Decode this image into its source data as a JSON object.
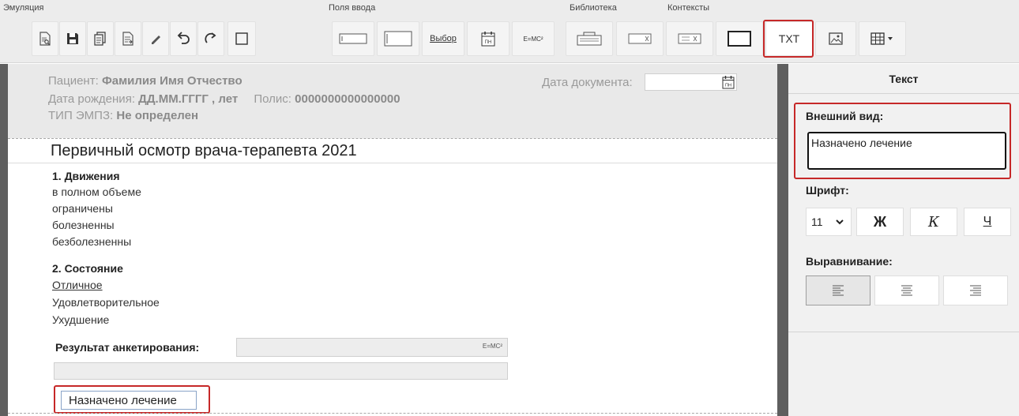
{
  "toolbar": {
    "groups": {
      "emulation": "Эмуляция",
      "inputs": "Поля ввода",
      "library": "Библиотека",
      "contexts": "Контексты"
    },
    "choice_label": "Выбор",
    "formula_label": "E=MC²",
    "calendar_label": "ПН",
    "txt_label": "TXT",
    "buttons": [
      "preview-icon",
      "save-icon",
      "copy-icon",
      "export-icon",
      "pencil-icon",
      "undo-icon",
      "redo-icon",
      "text-field-icon",
      "multiline-field-icon",
      "choice-button",
      "date-field-icon",
      "formula-icon",
      "library-icon",
      "clear-field-icon",
      "text-clear-field-icon",
      "frame-icon",
      "txt-button",
      "image-icon",
      "table-icon"
    ],
    "selected": "txt-button"
  },
  "document": {
    "header": {
      "patient_label": "Пациент:",
      "patient_value": "Фамилия Имя Отчество",
      "birth_label": "Дата рождения:",
      "birth_value": "ДД.ММ.ГГГГ , лет",
      "policy_label": "Полис:",
      "policy_value": "0000000000000000",
      "type_label": "ТИП ЭМПЗ:",
      "type_value": "Не определен",
      "date_label": "Дата документа:",
      "date_value": ""
    },
    "title": "Первичный осмотр врача-терапевта 2021",
    "sections": [
      {
        "heading": "1. Движения",
        "options": [
          "в полном объеме",
          "ограничены",
          "болезненны",
          "безболезненны"
        ]
      },
      {
        "heading": "2. Состояние",
        "options": [
          "Отличное",
          "Удовлетворительное",
          "Ухудшение"
        ],
        "selected": 0
      }
    ],
    "result_label": "Результат анкетирования:",
    "result_value": "",
    "treatment_text": "Назначено лечение"
  },
  "panel": {
    "title": "Текст",
    "appearance_label": "Внешний вид:",
    "appearance_value": "Назначено лечение",
    "font_label": "Шрифт:",
    "font_size": "11",
    "bold_label": "Ж",
    "italic_label": "К",
    "underline_label": "Ч",
    "align_label": "Выравнивание:",
    "align_selected": "left"
  },
  "colors": {
    "selection": "#c62828",
    "frame": "#5f5f5f",
    "panel_bg": "#f1f1f1",
    "header_bg": "#e9e9e9"
  }
}
